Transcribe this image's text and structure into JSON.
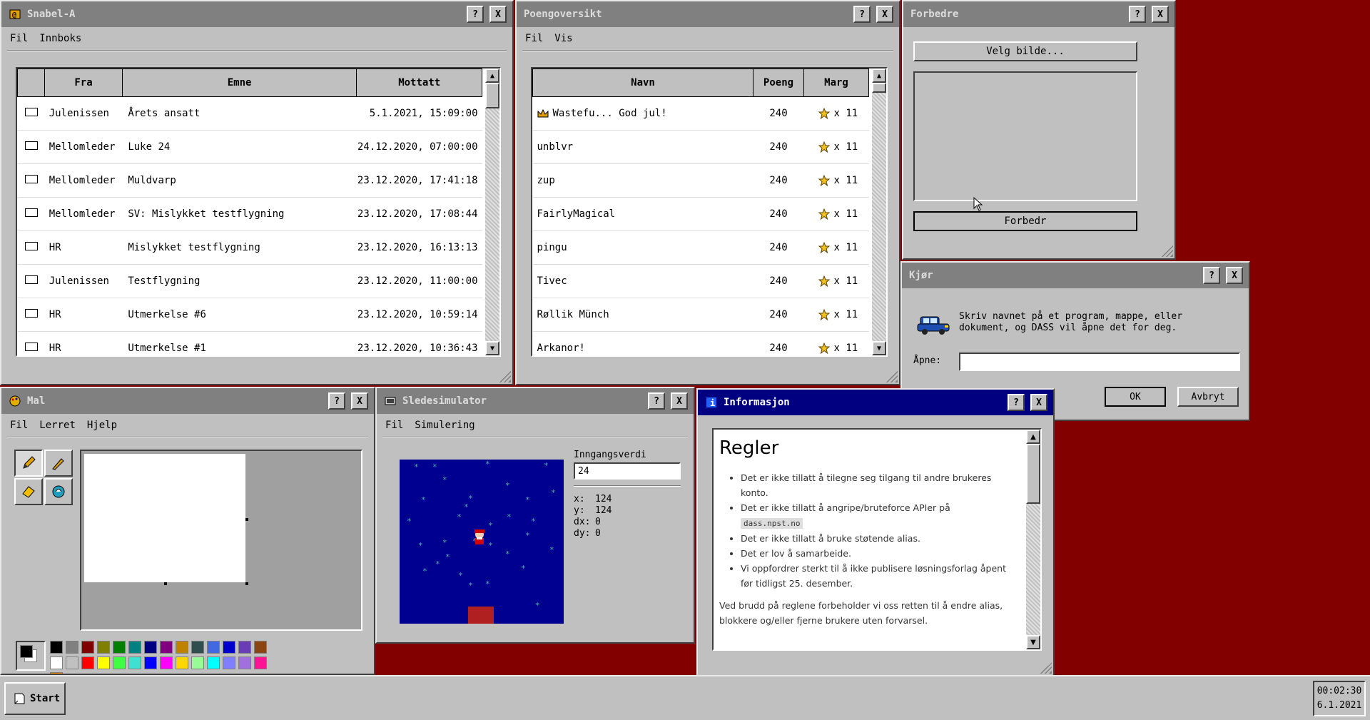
{
  "windows": {
    "mail": {
      "title": "Snabel-A",
      "menu": [
        "Fil",
        "Innboks"
      ],
      "columns": [
        "Fra",
        "Emne",
        "Mottatt"
      ],
      "rows": [
        {
          "from": "Julenissen",
          "subject": "Årets ansatt",
          "received": "5.1.2021, 15:09:00"
        },
        {
          "from": "Mellomleder",
          "subject": "Luke 24",
          "received": "24.12.2020, 07:00:00"
        },
        {
          "from": "Mellomleder",
          "subject": "Muldvarp",
          "received": "23.12.2020, 17:41:18"
        },
        {
          "from": "Mellomleder",
          "subject": "SV: Mislykket testflygning",
          "received": "23.12.2020, 17:08:44"
        },
        {
          "from": "HR",
          "subject": "Mislykket testflygning",
          "received": "23.12.2020, 16:13:13"
        },
        {
          "from": "Julenissen",
          "subject": "Testflygning",
          "received": "23.12.2020, 11:00:00"
        },
        {
          "from": "HR",
          "subject": "Utmerkelse #6",
          "received": "23.12.2020, 10:59:14"
        },
        {
          "from": "HR",
          "subject": "Utmerkelse #1",
          "received": "23.12.2020, 10:36:43"
        }
      ]
    },
    "scores": {
      "title": "Poengoversikt",
      "menu": [
        "Fil",
        "Vis"
      ],
      "columns": [
        "Navn",
        "Poeng",
        "Marg"
      ],
      "rows": [
        {
          "name": "Wastefu... God jul!",
          "points": "240",
          "marg": "x 11",
          "crown": true
        },
        {
          "name": "unblvr",
          "points": "240",
          "marg": "x 11"
        },
        {
          "name": "zup",
          "points": "240",
          "marg": "x 11"
        },
        {
          "name": "FairlyMagical",
          "points": "240",
          "marg": "x 11"
        },
        {
          "name": "pingu",
          "points": "240",
          "marg": "x 11"
        },
        {
          "name": "Tivec",
          "points": "240",
          "marg": "x 11"
        },
        {
          "name": "Røllik Münch",
          "points": "240",
          "marg": "x 11"
        },
        {
          "name": "Arkanor!",
          "points": "240",
          "marg": "x 11"
        }
      ]
    },
    "improve": {
      "title": "Forbedre",
      "choose_label": "Velg bilde...",
      "improve_label": "Forbedr"
    },
    "run": {
      "title": "Kjør",
      "message": "Skriv navnet på et program, mappe, eller dokument, og DASS vil åpne det for deg.",
      "open_label": "Åpne:",
      "open_value": "",
      "ok_label": "OK",
      "cancel_label": "Avbryt"
    },
    "paint": {
      "title": "Mal",
      "menu": [
        "Fil",
        "Lerret",
        "Hjelp"
      ],
      "colors": [
        "#000000",
        "#808080",
        "#800000",
        "#808000",
        "#008000",
        "#008080",
        "#000080",
        "#800080",
        "#c08000",
        "#2f4f4f",
        "#4169e1",
        "#0000cd",
        "#6a3db8",
        "#8b4513",
        "#ffffff",
        "#c0c0c0",
        "#ff0000",
        "#ffff00",
        "#40ff40",
        "#40e0d0",
        "#0000ff",
        "#ff00ff",
        "#ffd700",
        "#98fb98",
        "#00ffff",
        "#8080ff",
        "#a070e0",
        "#ff1493",
        "#ff8c00"
      ]
    },
    "sled": {
      "title": "Sledesimulator",
      "menu": [
        "Fil",
        "Simulering"
      ],
      "input_label": "Inngangsverdi",
      "input_value": "24",
      "readout": [
        {
          "k": "x:",
          "v": "124"
        },
        {
          "k": "y:",
          "v": "124"
        },
        {
          "k": "dx:",
          "v": "0"
        },
        {
          "k": "dy:",
          "v": "0"
        }
      ]
    },
    "info": {
      "title": "Informasjon",
      "heading": "Regler",
      "rules": [
        "Det er ikke tillatt å tilegne seg tilgang til andre brukeres konto.",
        "Det er ikke tillatt å angripe/bruteforce APIer på",
        "Det er ikke tillatt å bruke støtende alias.",
        "Det er lov å samarbeide.",
        "Vi oppfordrer sterkt til å ikke publisere løsningsforlag åpent før tidligst 25. desember."
      ],
      "domain_chip": "dass.npst.no",
      "footer": "Ved brudd på reglene forbeholder vi oss retten til å endre alias, blokkere og/eller fjerne brukere uten forvarsel."
    }
  },
  "taskbar": {
    "start_label": "Start",
    "time": "00:02:30",
    "date": "6.1.2021"
  },
  "colors": {
    "desktop": "#820000",
    "active_title": "#000080",
    "inactive_title": "#808080"
  }
}
